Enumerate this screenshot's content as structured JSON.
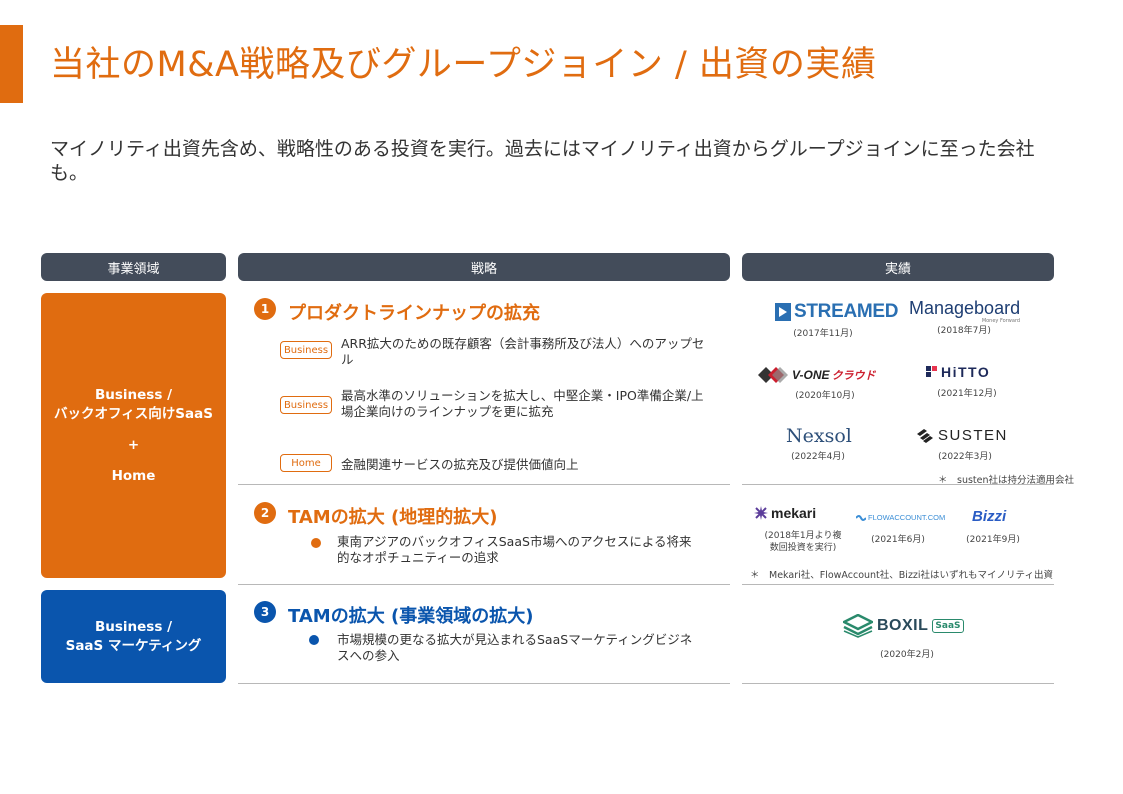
{
  "title": "当社のM&A戦略及びグループジョイン / 出資の実績",
  "subtitle": "マイノリティ出資先含め、戦略性のある投資を実行。過去にはマイノリティ出資からグループジョインに至った会社も。",
  "headers": {
    "domain": "事業領域",
    "strategy": "戦略",
    "results": "実績"
  },
  "domains": {
    "orange": {
      "line1": "Business /",
      "line2": "バックオフィス向けSaaS",
      "plus": "+",
      "line3": "Home"
    },
    "blue": {
      "line1": "Business /",
      "line2": "SaaS マーケティング"
    }
  },
  "strategies": [
    {
      "num": "1",
      "title": "プロダクトラインナップの拡充",
      "items": [
        {
          "tag": "Business",
          "text": "ARR拡大のための既存顧客（会計事務所及び法人）へのアップセル"
        },
        {
          "tag": "Business",
          "text": "最高水準のソリューションを拡大し、中堅企業・IPO準備企業/上場企業向けのラインナップを更に拡充"
        },
        {
          "tag": "Home",
          "text": "金融関連サービスの拡充及び提供価値向上"
        }
      ]
    },
    {
      "num": "2",
      "title": "TAMの拡大 (地理的拡大)",
      "bullet": "東南アジアのバックオフィスSaaS市場へのアクセスによる将来的なオポチュニティーの追求"
    },
    {
      "num": "3",
      "title": "TAMの拡大 (事業領域の拡大)",
      "bullet": "市場規模の更なる拡大が見込まれるSaaSマーケティングビジネスへの参入"
    }
  ],
  "results": {
    "streamed": {
      "logo": "STREAMED",
      "date": "(2017年11月)"
    },
    "manageboard": {
      "logo": "Manageboard",
      "sub": "Money Forward",
      "date": "(2018年7月)"
    },
    "vone": {
      "logo": "V-ONE",
      "logo2": "クラウド",
      "date": "(2020年10月)"
    },
    "hitto": {
      "logo": "HiTTO",
      "date": "(2021年12月)"
    },
    "nexsol": {
      "logo": "Nexsol",
      "date": "(2022年4月)"
    },
    "susten": {
      "logo": "SUSTEN",
      "date": "(2022年3月)"
    },
    "susten_note": "＊　susten社は持分法適用会社",
    "mekari": {
      "logo": "mekari",
      "date_line1": "(2018年1月より複",
      "date_line2": "数回投資を実行)"
    },
    "flowaccount": {
      "logo": "FLOWACCOUNT.COM",
      "date": "(2021年6月)"
    },
    "bizzi": {
      "logo": "Bizzi",
      "date": "(2021年9月)"
    },
    "minority_note": "＊　Mekari社、FlowAccount社、Bizzi社はいずれもマイノリティ出資",
    "boxil": {
      "logo": "BOXIL",
      "badge": "SaaS",
      "date": "(2020年2月)"
    }
  },
  "colors": {
    "orange": "#e06c10",
    "blue": "#0a55ad",
    "header": "#434c5a"
  }
}
